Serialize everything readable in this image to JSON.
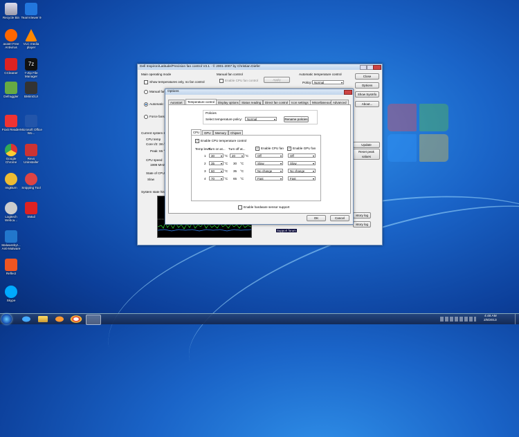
{
  "desktop": {
    "icons_left": [
      "Recycle Bin",
      "avast! Free Antivirus",
      "CCleaner",
      "Defraggler",
      "Foxit Reader",
      "Google Chrome",
      "ImgBurn",
      "Logitech Webca...",
      "Malwarebyt... Anti-Malware",
      "Reflect",
      "Skype"
    ],
    "icons_right": [
      "TeamViewer 9",
      "VLC media player",
      "7-Zip File Manager",
      "BMimGUI",
      "Microsoft Office Wo...",
      "Revo Uninstaller",
      "Snipping Tool",
      "SMail"
    ]
  },
  "main_window": {
    "title": "Dell Inspiron/Latitude/Precision fan control V3.1 - © 2001-2007 by Christian Diefer",
    "main_mode_label": "Main operating mode",
    "opt_show_temps": "Show temperatures only, no fan control",
    "opt_manual": "Manual fan c",
    "opt_automatic": "Automatic te",
    "opt_force": "Force fans t",
    "manual_fan_label": "Manual fan control",
    "enable_cpu_fan_control": "Enable CPU fan control",
    "apply_label": "Apply",
    "auto_temp_label": "Automatic temperature control",
    "policy_label": "Policy:",
    "policy_value": "Normal",
    "btn_close": "Close",
    "btn_options": "Options",
    "btn_show_sysinfo": "Show SysInfo",
    "btn_about": "About...",
    "btn_update": "Update",
    "btn_reset_peak": "Reset peak values",
    "btn_history_log_1": "istory log",
    "btn_history_log_2": "istory log",
    "current_state_label": "Current system sta",
    "cpu_temp_label": "CPU temp",
    "cpu_temp_value": "Core I/2: 38 / 3",
    "peak_label": "Peak: 65 °C",
    "cpu_speed_label": "CPU speed",
    "cpu_speed_value": "1999 MHz",
    "cpu_fan_state_label": "State of CPU fa",
    "cpu_fan_state_value": "Slow",
    "history_label": "System state histor",
    "support_forum": "Support forum"
  },
  "options_dialog": {
    "title": "Options",
    "tabs": [
      "Autostart",
      "Temperature control",
      "Display options",
      "Status reading",
      "Direct fan control",
      "Icon settings",
      "Miscellaneous",
      "Advanced"
    ],
    "policies_label": "Policies",
    "select_policy_label": "Select temperature policy:",
    "select_policy_value": "Normal",
    "rename_policies": "Rename policies",
    "subtabs": [
      "CPU",
      "GPU",
      "Memory",
      "Chipset"
    ],
    "enable_cpu_temp_control": "Enable CPU temperature control",
    "temp_level_header": "Temp level",
    "turn_on_header": "Turn on at...",
    "turn_off_header": "Turn off at...",
    "enable_cpu_fan": "Enable CPU fan",
    "enable_gpu_fan": "Enable GPU fan",
    "unit": "°C",
    "rows": [
      {
        "level": "1",
        "on": "30",
        "off": "20",
        "cpu": "Off",
        "gpu": "Off"
      },
      {
        "level": "2",
        "on": "35",
        "off": "30",
        "cpu": "Slow",
        "gpu": "Slow"
      },
      {
        "level": "3",
        "on": "60",
        "off": "35",
        "cpu": "No change",
        "gpu": "No change"
      },
      {
        "level": "4",
        "on": "70",
        "off": "65",
        "cpu": "Fast",
        "gpu": "Fast"
      }
    ],
    "enable_hw_sensor": "Enable hardware sensor support",
    "ok": "OK",
    "cancel": "Cancel"
  },
  "taskbar": {
    "time": "4:48 AM",
    "date": "2/8/2013"
  }
}
